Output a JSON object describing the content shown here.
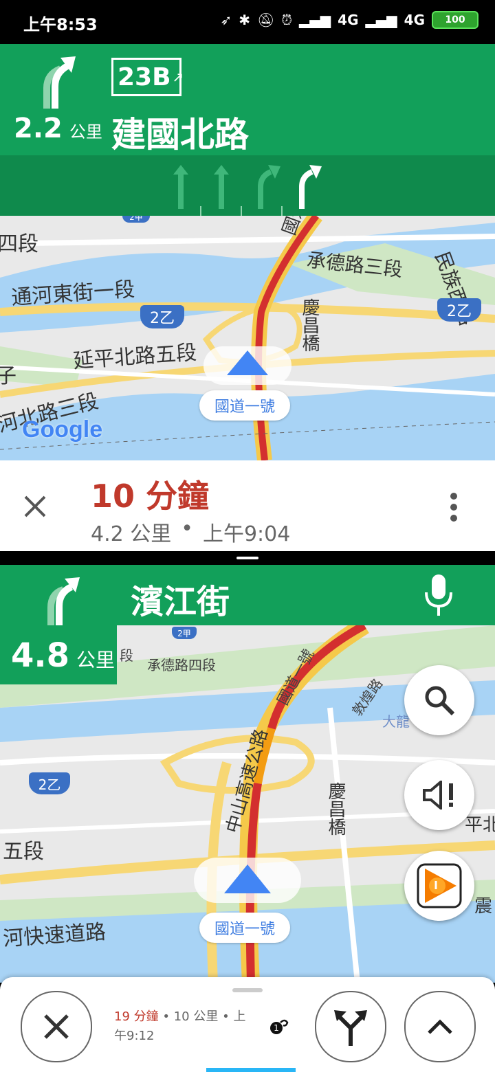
{
  "status_bar": {
    "time": "上午8:53",
    "net1": "4G",
    "net2": "4G",
    "battery": "100"
  },
  "primary_nav": {
    "distance_value": "2.2",
    "distance_unit": "公里",
    "exit_badge": "23B",
    "street": "建國北路"
  },
  "map1": {
    "labels": [
      "四段",
      "通河東街一段",
      "延平北路五段",
      "子",
      "河北路三段",
      "承德路三段",
      "民族西路",
      "國道一號",
      "慶昌橋"
    ],
    "shields": [
      "2乙",
      "2乙",
      "2甲"
    ],
    "road_chip": "國道一號",
    "attribution": "Google"
  },
  "eta_card": {
    "minutes": "10 分鐘",
    "distance": "4.2 公里",
    "separator": "•",
    "arrival": "上午9:04"
  },
  "secondary_nav": {
    "street": "濱江街",
    "distance_value": "4.8",
    "distance_unit": "公里"
  },
  "map2": {
    "labels": [
      "段",
      "承德路四段",
      "國道一號",
      "敦煌路",
      "大龍",
      "中山高速公路",
      "慶昌橋",
      "五段",
      "河快速道路",
      "平北",
      "震",
      "段"
    ],
    "shields": [
      "2甲",
      "2乙"
    ],
    "road_chip": "國道一號"
  },
  "bottom_bar": {
    "minutes": "19 分鐘",
    "dot": "•",
    "distance": "10 公里",
    "arrival_line1": "上",
    "arrival_line2": "午9:12"
  },
  "icons": {
    "close": "close-icon",
    "more": "more-vert-icon",
    "mic": "microphone-icon",
    "search": "search-icon",
    "sound": "sound-alert-icon",
    "music": "google-play-music-icon",
    "alternate": "alternate-routes-icon",
    "expand": "chevron-up-icon"
  },
  "colors": {
    "nav_green": "#12a05a",
    "lane_green": "#0f8a4c",
    "traffic_red": "#d32f2f",
    "eta_red": "#c0392b",
    "route_blue": "#4285f4"
  }
}
